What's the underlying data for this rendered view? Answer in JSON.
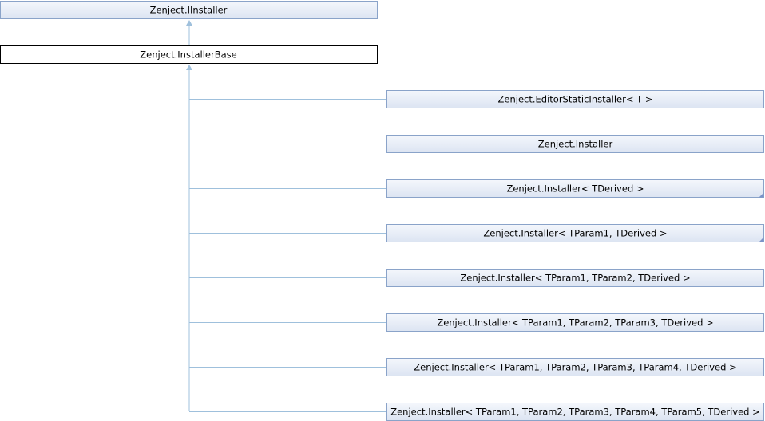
{
  "colors": {
    "box_border": "#8aa3c9",
    "box_fill_top": "#f4f7fc",
    "box_fill_bottom": "#dce4f2",
    "current_border": "#000000",
    "edge": "#9fc0dc"
  },
  "interface": {
    "label": "Zenject.IInstaller"
  },
  "base": {
    "label": "Zenject.InstallerBase"
  },
  "derived": [
    {
      "label": "Zenject.EditorStaticInstaller< T >",
      "has_more": false
    },
    {
      "label": "Zenject.Installer",
      "has_more": false
    },
    {
      "label": "Zenject.Installer< TDerived >",
      "has_more": true
    },
    {
      "label": "Zenject.Installer< TParam1, TDerived >",
      "has_more": true
    },
    {
      "label": "Zenject.Installer< TParam1, TParam2, TDerived >",
      "has_more": false
    },
    {
      "label": "Zenject.Installer< TParam1, TParam2, TParam3, TDerived >",
      "has_more": false
    },
    {
      "label": "Zenject.Installer< TParam1, TParam2, TParam3, TParam4, TDerived >",
      "has_more": false
    },
    {
      "label": "Zenject.Installer< TParam1, TParam2, TParam3, TParam4, TParam5, TDerived >",
      "has_more": false
    }
  ]
}
